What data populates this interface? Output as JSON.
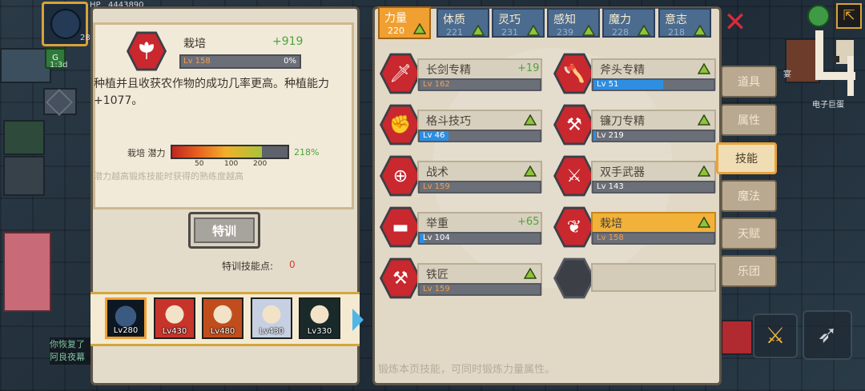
{
  "hud": {
    "hp_label": "HP",
    "hp_value": "4443890",
    "level_badge": "28",
    "timer": "1:3d",
    "chat_line1": "你恢复了",
    "chat_line2": "阿良夜幕"
  },
  "skill_detail": {
    "name": "栽培",
    "gain": "+919",
    "level": "Lv 158",
    "progress_text": "0%",
    "progress": 0,
    "description": "种植并且收获农作物的成功几率更高。种植能力+1077。",
    "potential_label": "栽培 潜力",
    "potential_ticks": [
      "50",
      "100",
      "200"
    ],
    "potential_value": "218%",
    "potential_hint": "潜力越高锻炼技能时获得的熟练度越高"
  },
  "training": {
    "button_label": "特训",
    "points_label": "特训技能点:",
    "points_value": "0"
  },
  "heroes": [
    {
      "level": "Lv280",
      "color": "#1c2f45"
    },
    {
      "level": "Lv430",
      "color": "#c7342a"
    },
    {
      "level": "Lv480",
      "color": "#c14d1d"
    },
    {
      "level": "Lv430",
      "color": "#c6d0e2"
    },
    {
      "level": "Lv330",
      "color": "#1a2a2a"
    }
  ],
  "attribute_tabs": [
    {
      "name": "力量",
      "value": "220",
      "active": true
    },
    {
      "name": "体质",
      "value": "221"
    },
    {
      "name": "灵巧",
      "value": "231"
    },
    {
      "name": "感知",
      "value": "239"
    },
    {
      "name": "魔力",
      "value": "228"
    },
    {
      "name": "意志",
      "value": "218"
    }
  ],
  "skills": [
    {
      "name": "长剑专精",
      "level": "Lv 162",
      "gain": "+19",
      "progress": 0,
      "icon": "sword-icon"
    },
    {
      "name": "斧头专精",
      "level": "Lv 51",
      "progress": 0.58,
      "icon": "axe-icon",
      "up": true
    },
    {
      "name": "格斗技巧",
      "level": "Lv 46",
      "progress": 0.24,
      "icon": "fist-icon",
      "up": true
    },
    {
      "name": "镰刀专精",
      "level": "Lv 219",
      "progress": 0.02,
      "icon": "sickle-icon",
      "up": true
    },
    {
      "name": "战术",
      "level": "Lv 159",
      "progress": 0,
      "icon": "tactics-icon",
      "up": true
    },
    {
      "name": "双手武器",
      "level": "Lv 143",
      "progress": 0,
      "icon": "two-hand-weapon-icon",
      "up": true
    },
    {
      "name": "举重",
      "level": "Lv 104",
      "gain": "+65",
      "progress": 0.04,
      "icon": "dumbbell-icon"
    },
    {
      "name": "栽培",
      "level": "Lv 158",
      "progress": 0,
      "icon": "leaf-icon",
      "up": true,
      "selected": true
    },
    {
      "name": "铁匠",
      "level": "Lv 159",
      "progress": 0,
      "icon": "anvil-icon",
      "up": true
    }
  ],
  "footer_hint": "锻炼本页技能，可同时锻炼力量属性。",
  "side_tabs": [
    {
      "label": "道具"
    },
    {
      "label": "属性"
    },
    {
      "label": "技能",
      "active": true
    },
    {
      "label": "魔法"
    },
    {
      "label": "天赋"
    },
    {
      "label": "乐团"
    }
  ],
  "map": {
    "label": "电子巨蛋",
    "partial_label": "宴"
  },
  "colors": {
    "accent": "#f0a030",
    "skill_red": "#c8282e",
    "up_green": "#8fc33a",
    "bar_blue": "#2e8ee0"
  }
}
